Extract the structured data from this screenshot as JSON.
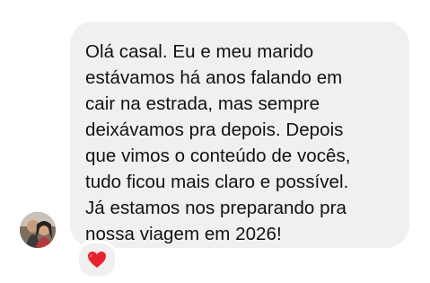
{
  "message": {
    "text": "Olá casal. Eu e meu marido\nestávamos há anos falando em\ncair na estrada, mas sempre\ndeixávamos pra depois. Depois\nque vimos o conteúdo de vocês,\ntudo ficou mais claro e possível.\nJá estamos nos preparando pra\nnossa viagem em 2026!",
    "reaction": "heart-reaction"
  },
  "colors": {
    "bubble": "#f0f0f0",
    "text": "#111111",
    "heart": "#e8232f"
  }
}
